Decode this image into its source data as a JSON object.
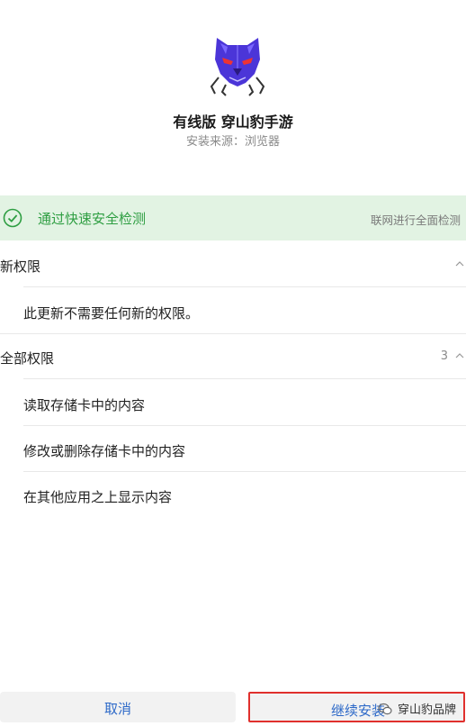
{
  "app": {
    "name": "有线版 穿山豹手游",
    "install_source": "安装来源：浏览器",
    "icon": "panther-logo-icon"
  },
  "scan": {
    "status_text": "通过快速安全检测",
    "full_scan_link": "联网进行全面检测",
    "status_color": "#2e9e42"
  },
  "new_permissions": {
    "title": "新权限",
    "items": [
      "此更新不需要任何新的权限。"
    ]
  },
  "all_permissions": {
    "title": "全部权限",
    "count": "3",
    "items": [
      "读取存储卡中的内容",
      "修改或删除存储卡中的内容",
      "在其他应用之上显示内容"
    ]
  },
  "buttons": {
    "cancel": "取消",
    "install": "继续安装"
  },
  "watermark": {
    "text": "穿山豹品牌"
  },
  "colors": {
    "accent_blue": "#2d69c8",
    "highlight_red": "#e0302d",
    "banner_green_bg": "#e2f3e3"
  }
}
